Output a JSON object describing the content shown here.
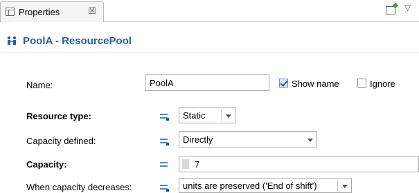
{
  "tab": {
    "label": "Properties",
    "close": "☒"
  },
  "toolbar": {
    "pin_icon": "pin-icon",
    "view_menu": "▽"
  },
  "header": {
    "icon": "resource-pool-icon",
    "title": "PoolA - ResourcePool"
  },
  "colors": {
    "accent": "#2a5ea8",
    "eq_icon": "#3a8ed6",
    "border": "#a8a8a8"
  },
  "form": {
    "name": {
      "label": "Name:",
      "value": "PoolA"
    },
    "show_name": {
      "label": "Show name",
      "checked": true
    },
    "ignore": {
      "label": "Ignore",
      "checked": false
    },
    "resource_type": {
      "label": "Resource type:",
      "value": "Static"
    },
    "capacity_defined": {
      "label": "Capacity defined:",
      "value": "Directly"
    },
    "capacity": {
      "label": "Capacity:",
      "value": "7"
    },
    "when_capacity_decreases": {
      "label": "When capacity decreases:",
      "value": "units are preserved ('End of shift')"
    }
  }
}
